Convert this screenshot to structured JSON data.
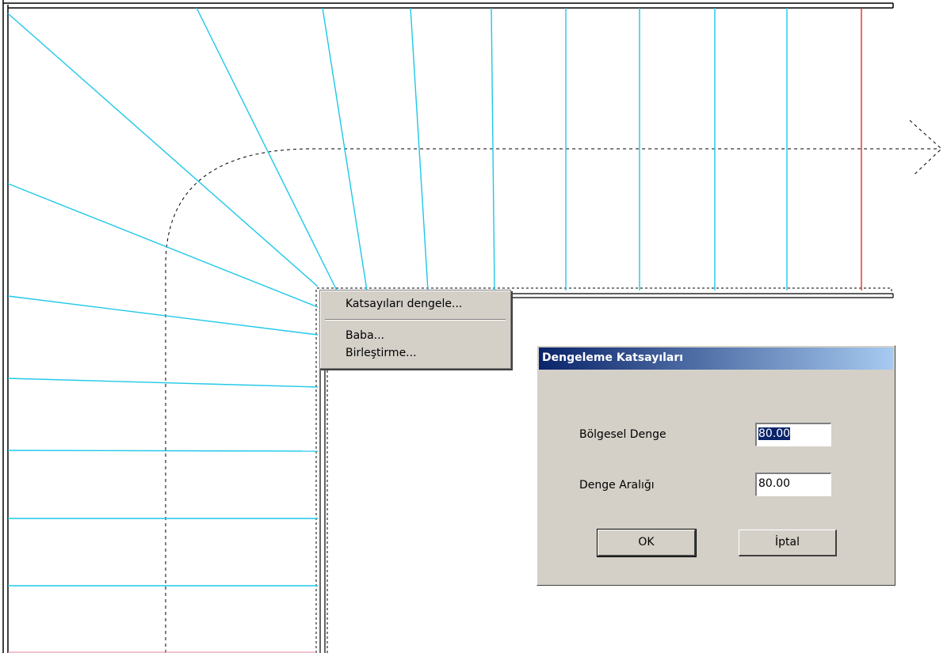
{
  "context_menu": {
    "items": [
      {
        "label": "Katsayıları dengele..."
      },
      {
        "label": "Baba..."
      },
      {
        "label": "Birleştirme..."
      }
    ]
  },
  "dialog": {
    "title": "Dengeleme Katsayıları",
    "fields": [
      {
        "label": "Bölgesel Denge",
        "value": "80.00",
        "selected": true
      },
      {
        "label": "Denge Aralığı",
        "value": "80.00",
        "selected": false
      }
    ],
    "ok_label": "OK",
    "cancel_label": "İptal"
  },
  "colors": {
    "step_line": "#1ec8e8",
    "highlight_line": "#e8282c",
    "titlebar_start": "#0a246a",
    "titlebar_end": "#a6caf0",
    "dialog_bg": "#d4d0c8"
  }
}
